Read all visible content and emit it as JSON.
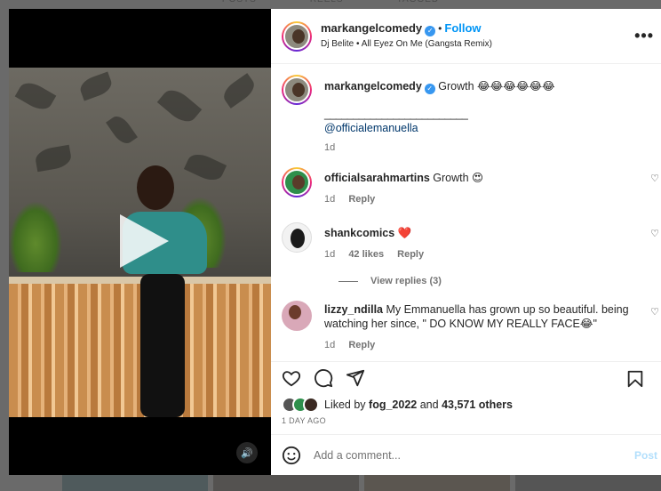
{
  "background": {
    "tabs": [
      "POSTS",
      "REELS",
      "TAGGED"
    ]
  },
  "post": {
    "username": "markangelcomedy",
    "follow_label": "Follow",
    "audio": "Dj Belite • All Eyez On Me (Gangsta Remix)",
    "more_label": "•••"
  },
  "caption": {
    "username": "markangelcomedy",
    "text": "Growth 😂😂😂😂😂😂",
    "divider": "_________________________",
    "mention": "@officialemanuella",
    "time": "1d"
  },
  "comments": [
    {
      "username": "officialsarahmartins",
      "text": "Growth 😍",
      "time": "1d",
      "likes": "",
      "reply_label": "Reply"
    },
    {
      "username": "shankcomics",
      "text": "❤️",
      "time": "1d",
      "likes": "42 likes",
      "reply_label": "Reply"
    },
    {
      "username": "lizzy_ndilla",
      "text": "My Emmanuella has grown up so beautiful. being watching her since, \" DO KNOW MY REALLY FACE😂\"",
      "time": "1d",
      "likes": "",
      "reply_label": "Reply"
    }
  ],
  "view_replies": "View replies (3)",
  "likes": {
    "prefix": "Liked by",
    "user": "fog_2022",
    "middle": "and",
    "count": "43,571 others"
  },
  "date": "1 DAY AGO",
  "composer": {
    "placeholder": "Add a comment...",
    "post_label": "Post"
  },
  "colors": {
    "link": "#00376b",
    "follow": "#0095f6",
    "verified": "#3797f0"
  }
}
